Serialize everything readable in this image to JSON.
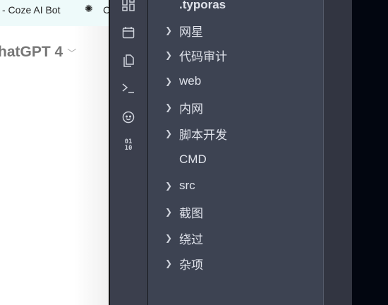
{
  "browser": {
    "bookmarks": [
      {
        "label": "- Coze AI Bot"
      },
      {
        "label": "C",
        "icon": "openai-icon"
      }
    ],
    "model_selector": "hatGPT 4"
  },
  "rail": {
    "icons": [
      "outline-icon",
      "calendar-icon",
      "copy-icon",
      "terminal-icon",
      "emoji-icon",
      "binary-icon"
    ]
  },
  "tree": {
    "items": [
      {
        "label": ".typoras",
        "folder": false,
        "bold": true
      },
      {
        "label": "网星",
        "folder": true
      },
      {
        "label": "代码审计",
        "folder": true
      },
      {
        "label": "web",
        "folder": true
      },
      {
        "label": "内网",
        "folder": true
      },
      {
        "label": "脚本开发",
        "folder": true
      },
      {
        "label": "CMD",
        "folder": false
      },
      {
        "label": "src",
        "folder": true
      },
      {
        "label": "截图",
        "folder": true
      },
      {
        "label": "绕过",
        "folder": true
      },
      {
        "label": "杂项",
        "folder": true
      }
    ]
  }
}
